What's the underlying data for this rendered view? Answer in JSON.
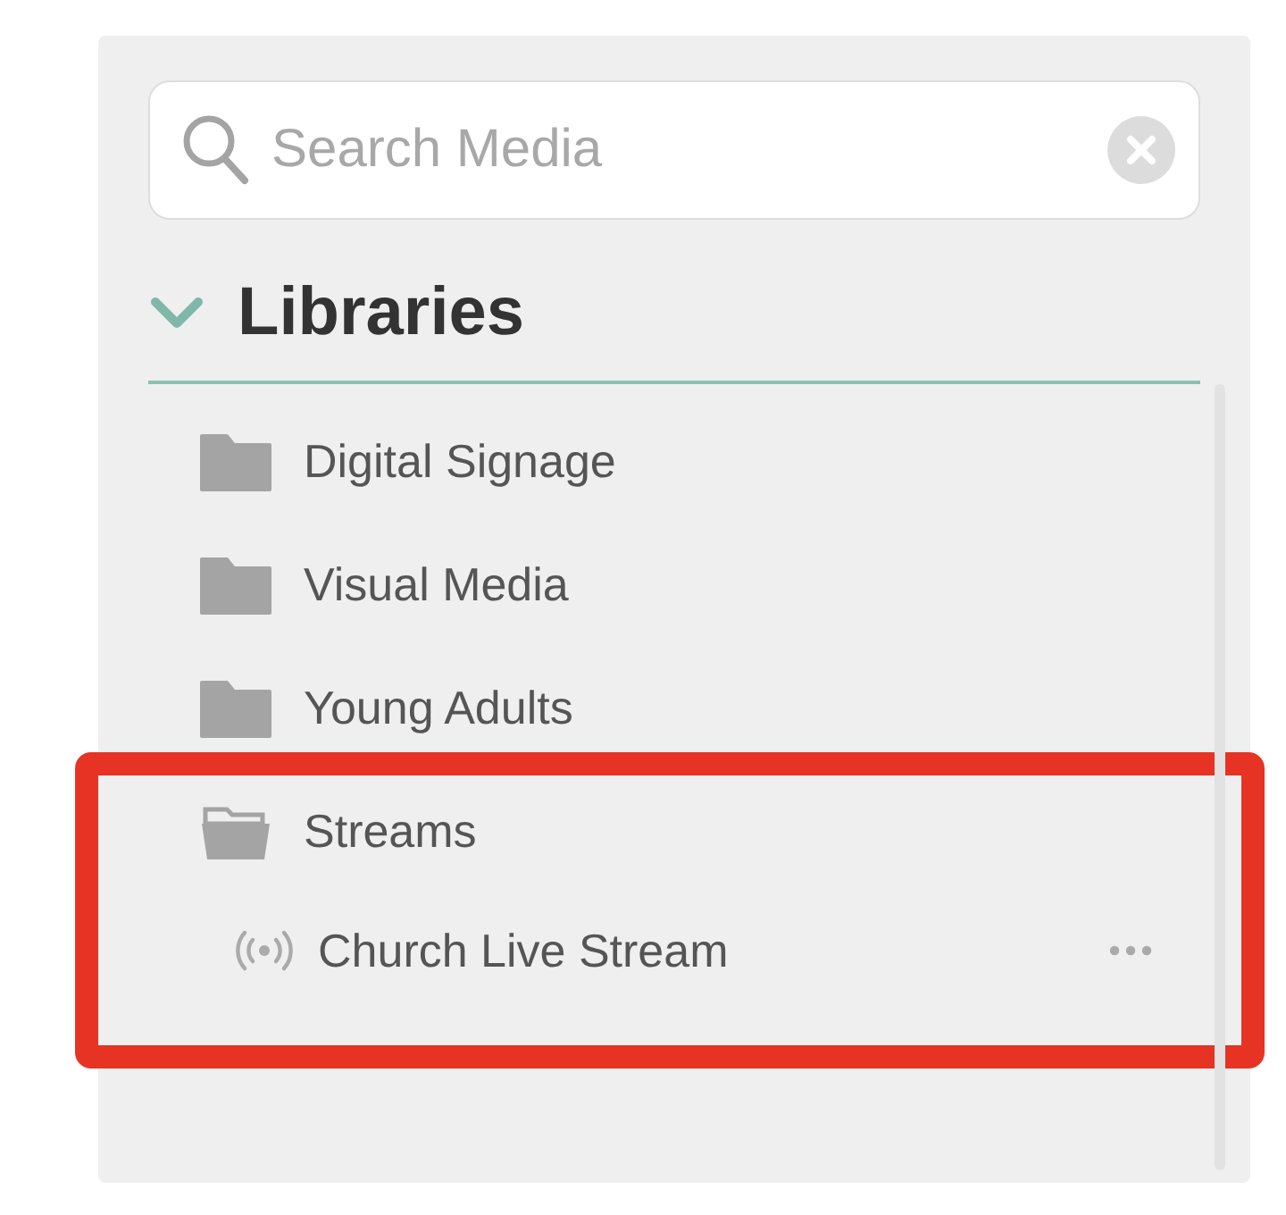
{
  "search": {
    "placeholder": "Search Media"
  },
  "libraries": {
    "title": "Libraries",
    "expanded": true,
    "items": [
      {
        "label": "Digital Signage",
        "kind": "folder",
        "expanded": false,
        "highlighted": false
      },
      {
        "label": "Visual Media",
        "kind": "folder",
        "expanded": false,
        "highlighted": false
      },
      {
        "label": "Young Adults",
        "kind": "folder",
        "expanded": false,
        "highlighted": false
      },
      {
        "label": "Streams",
        "kind": "folder",
        "expanded": true,
        "highlighted": true,
        "children": [
          {
            "label": "Church Live Stream",
            "kind": "stream"
          }
        ]
      }
    ]
  }
}
